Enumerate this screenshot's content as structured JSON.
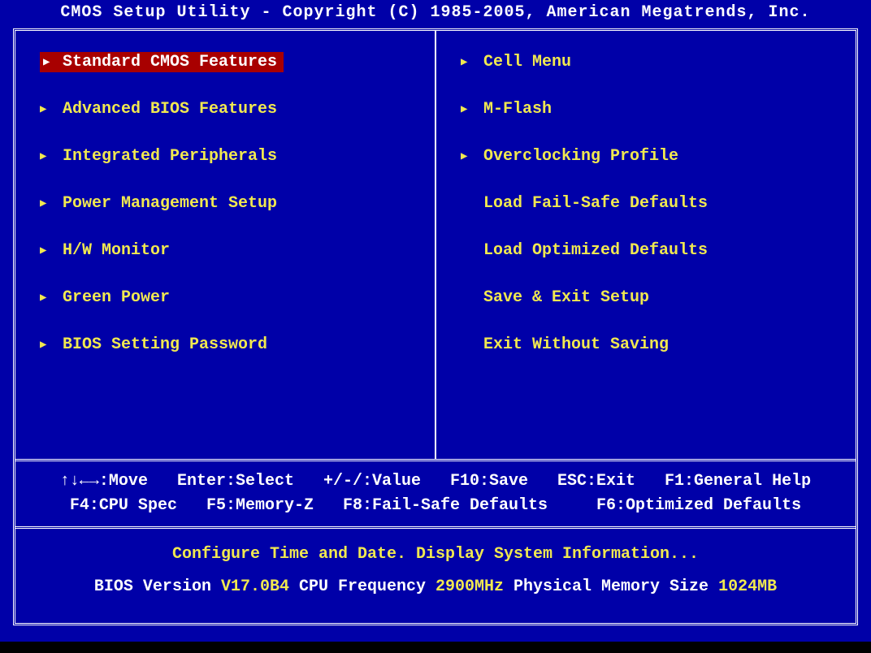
{
  "title": "CMOS Setup Utility - Copyright (C) 1985-2005, American Megatrends, Inc.",
  "menu": {
    "left": [
      {
        "label": "Standard CMOS Features",
        "hasSubmenu": true,
        "selected": true
      },
      {
        "label": "Advanced BIOS Features",
        "hasSubmenu": true,
        "selected": false
      },
      {
        "label": "Integrated Peripherals",
        "hasSubmenu": true,
        "selected": false
      },
      {
        "label": "Power Management Setup",
        "hasSubmenu": true,
        "selected": false
      },
      {
        "label": "H/W Monitor",
        "hasSubmenu": true,
        "selected": false
      },
      {
        "label": "Green Power",
        "hasSubmenu": true,
        "selected": false
      },
      {
        "label": "BIOS Setting Password",
        "hasSubmenu": true,
        "selected": false
      }
    ],
    "right": [
      {
        "label": "Cell Menu",
        "hasSubmenu": true,
        "selected": false
      },
      {
        "label": "M-Flash",
        "hasSubmenu": true,
        "selected": false
      },
      {
        "label": "Overclocking Profile",
        "hasSubmenu": true,
        "selected": false
      },
      {
        "label": "Load Fail-Safe Defaults",
        "hasSubmenu": false,
        "selected": false
      },
      {
        "label": "Load Optimized Defaults",
        "hasSubmenu": false,
        "selected": false
      },
      {
        "label": "Save & Exit Setup",
        "hasSubmenu": false,
        "selected": false
      },
      {
        "label": "Exit Without Saving",
        "hasSubmenu": false,
        "selected": false
      }
    ]
  },
  "help": {
    "line1": "↑↓←→:Move   Enter:Select   +/-/:Value   F10:Save   ESC:Exit   F1:General Help",
    "line2": "F4:CPU Spec   F5:Memory-Z   F8:Fail-Safe Defaults     F6:Optimized Defaults"
  },
  "info": {
    "description": "Configure Time and Date.  Display System Information...",
    "bios_version_label": "BIOS Version ",
    "bios_version": "V17.0B4",
    "cpu_freq_label": " CPU Frequency ",
    "cpu_freq": "2900MHz",
    "mem_label": " Physical Memory Size ",
    "mem_size": "1024MB"
  }
}
